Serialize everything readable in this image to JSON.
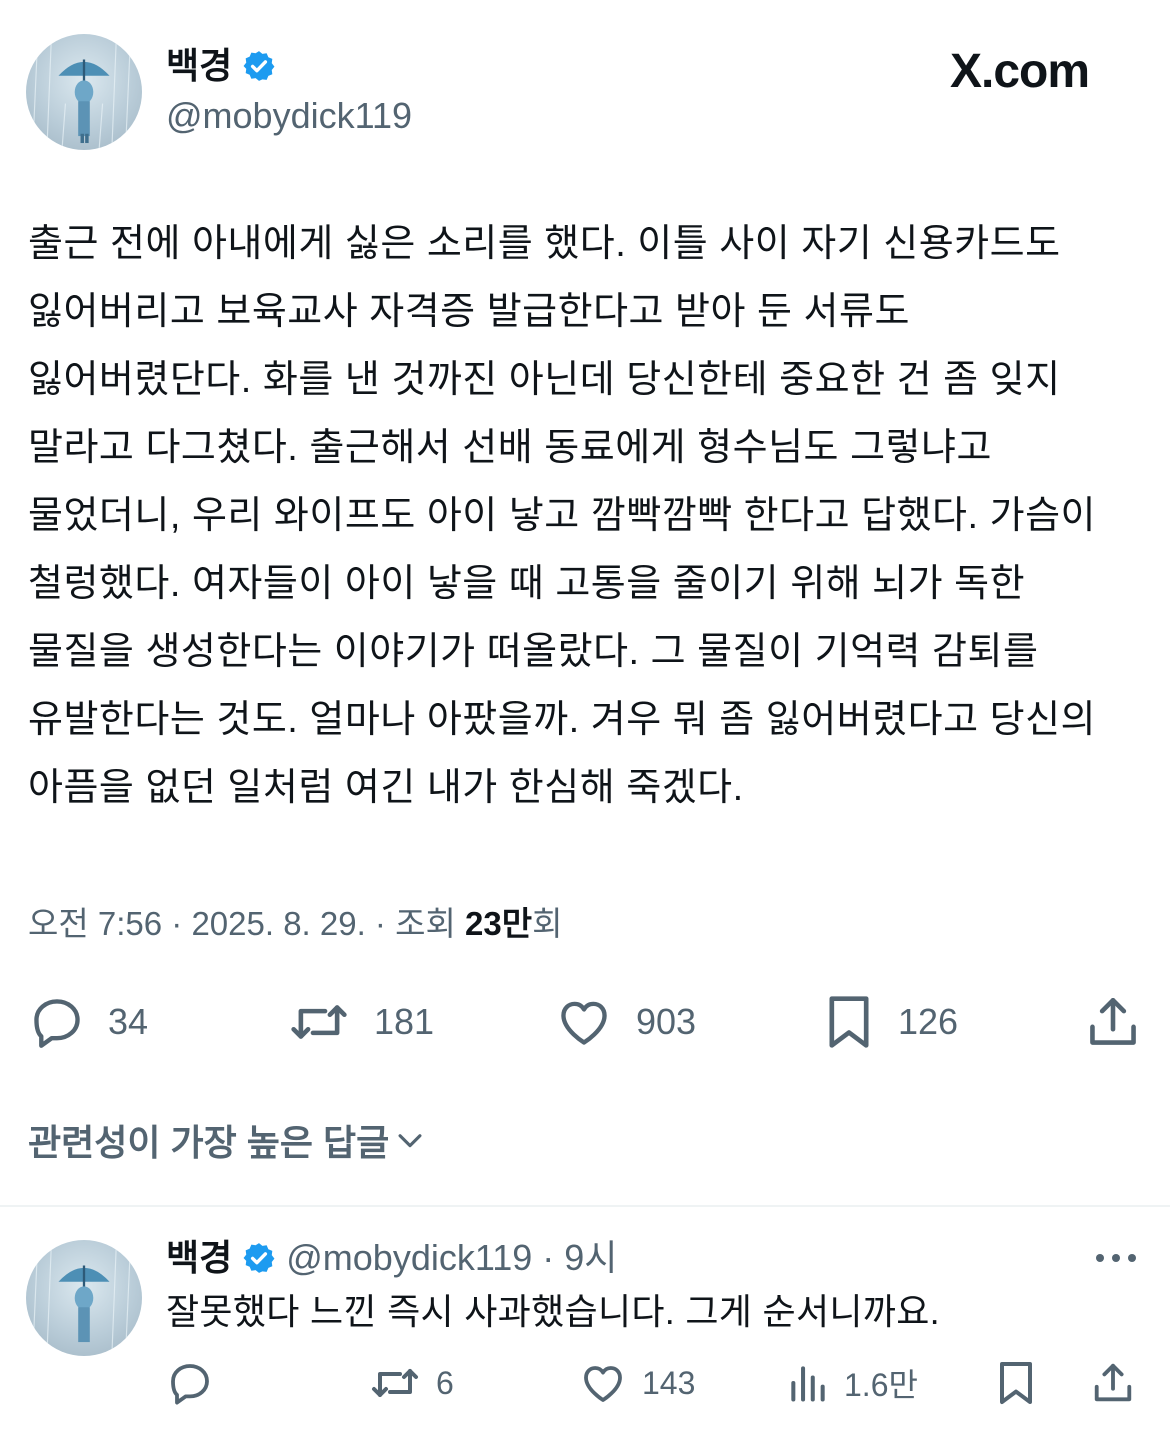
{
  "brand": {
    "watermark": "X.com"
  },
  "author": {
    "name": "백경",
    "handle": "@mobydick119",
    "verified": true,
    "avatar_icon": "umbrella-figure-in-rain-avatar"
  },
  "tweet": {
    "text": "출근 전에 아내에게 싫은 소리를 했다. 이틀 사이 자기 신용카드도 잃어버리고 보육교사 자격증 발급한다고 받아 둔 서류도 잃어버렸단다. 화를 낸 것까진 아닌데 당신한테 중요한 건 좀 잊지 말라고 다그쳤다. 출근해서 선배 동료에게 형수님도 그렇냐고 물었더니, 우리 와이프도 아이 낳고 깜빡깜빡 한다고 답했다. 가슴이 철렁했다. 여자들이 아이 낳을 때 고통을 줄이기 위해 뇌가 독한 물질을 생성한다는 이야기가 떠올랐다. 그 물질이 기억력 감퇴를 유발한다는 것도. 얼마나 아팠을까. 겨우 뭐 좀 잃어버렸다고 당신의 아픔을 없던 일처럼 여긴 내가 한심해 죽겠다.",
    "time": "오전 7:56 · 2025. 8. 29. · 조회 ",
    "views": "23만",
    "views_suffix": "회",
    "actions": {
      "reply": {
        "icon": "reply-icon",
        "count": "34"
      },
      "retweet": {
        "icon": "retweet-icon",
        "count": "181"
      },
      "like": {
        "icon": "heart-icon",
        "count": "903"
      },
      "bookmark": {
        "icon": "bookmark-icon",
        "count": "126"
      },
      "share": {
        "icon": "share-icon"
      }
    }
  },
  "replies_section": {
    "label": "관련성이 가장 높은 답글",
    "icon": "chevron-down-icon"
  },
  "reply": {
    "name": "백경",
    "handle": "@mobydick119",
    "time": "· 9시",
    "text": "잘못했다 느낀 즉시 사과했습니다. 그게 순서니까요.",
    "more_icon": "more-dots-icon",
    "actions": {
      "reply": {
        "icon": "reply-icon",
        "count": ""
      },
      "retweet": {
        "icon": "retweet-icon",
        "count": "6"
      },
      "like": {
        "icon": "heart-icon",
        "count": "143"
      },
      "views": {
        "icon": "analytics-icon",
        "count": "1.6만"
      },
      "bookmark": {
        "icon": "bookmark-icon"
      },
      "share": {
        "icon": "share-icon"
      }
    }
  },
  "colors": {
    "verified": "#1d9bf0",
    "muted": "#536471",
    "text": "#0f1419",
    "divider": "#eff3f4"
  }
}
